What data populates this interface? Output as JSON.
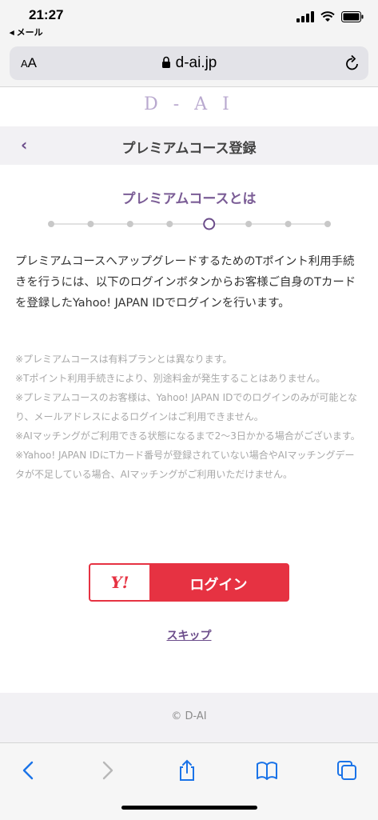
{
  "status_bar": {
    "time": "21:27",
    "back_app": "◂ メール"
  },
  "address_bar": {
    "text_size": "AA",
    "url": "d-ai.jp"
  },
  "site": {
    "logo": "D - A I"
  },
  "nav": {
    "back": "‹",
    "title": "プレミアムコース登録"
  },
  "content": {
    "heading": "プレミアムコースとは",
    "stepper": {
      "total_steps": 8,
      "current_step": 5
    },
    "intro": "プレミアムコースへアップグレードするためのTポイント利用手続きを行うには、以下のログインボタンからお客様ご自身のTカードを登録したYahoo! JAPAN IDでログインを行います。",
    "notes": [
      "※プレミアムコースは有料プランとは異なります。",
      "※Tポイント利用手続きにより、別途料金が発生することはありません。",
      "※プレミアムコースのお客様は、Yahoo! JAPAN IDでのログインのみが可能となり、メールアドレスによるログインはご利用できません。",
      "※AIマッチングがご利用できる状態になるまで2〜3日かかる場合がございます。",
      "※Yahoo! JAPAN IDにTカード番号が登録されていない場合やAIマッチングデータが不足している場合、AIマッチングがご利用いただけません。"
    ],
    "login_logo": "Y!",
    "login_label": "ログイン",
    "skip": "スキップ"
  },
  "footer": {
    "copyright": "© D-AI"
  },
  "colors": {
    "accent": "#6b4c8a",
    "yahoo_red": "#e63242",
    "ios_blue": "#1a73e8"
  }
}
